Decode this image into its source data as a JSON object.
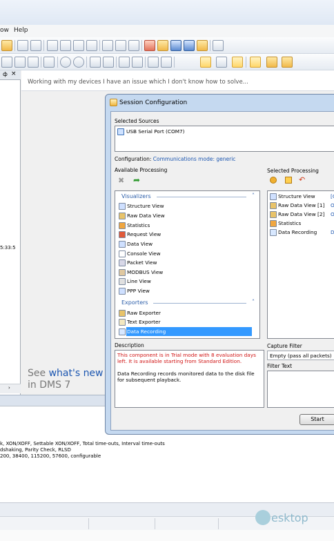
{
  "menu": {
    "view": "ow",
    "help": "Help"
  },
  "left_pane": {
    "pin": "ф",
    "close": "×",
    "timestamp": "5:33:5"
  },
  "doc": {
    "tab_text": "Working with my devices I have an issue which I don't know how to solve...",
    "whats_new_prefix": "See",
    "whats_new_link": "what's new",
    "whats_new_suffix": "in DMS 7"
  },
  "dialog": {
    "title": "Session Configuration",
    "selected_sources_label": "Selected Sources",
    "source_item": "USB Serial Port (COM7)",
    "configuration_label": "Configuration:",
    "configuration_value": "Communications mode: generic",
    "available_processing_label": "Available Processing",
    "selected_processing_label": "Selected Processing",
    "visualizers_header": "Visualizers",
    "visualizers": [
      "Structure View",
      "Raw Data View",
      "Statistics",
      "Request View",
      "Data View",
      "Console View",
      "Packet View",
      "MODBUS View",
      "Line View",
      "PPP View"
    ],
    "exporters_header": "Exporters",
    "exporters": [
      "Raw Exporter",
      "Text Exporter",
      "Data Recording"
    ],
    "selected_items": [
      {
        "name": "Structure View",
        "suffix": "[C"
      },
      {
        "name": "Raw Data View [1]",
        "suffix": "O"
      },
      {
        "name": "Raw Data View [2]",
        "suffix": "O"
      },
      {
        "name": "Statistics",
        "suffix": ""
      },
      {
        "name": "Data Recording",
        "suffix": "D"
      }
    ],
    "description_label": "Description",
    "description_trial": "This component is in Trial mode with 8 evaluation days left. It is available starting from Standard Edition.",
    "description_text": "Data Recording records monitored data to the disk file for subsequent playback.",
    "capture_filter_label": "Capture Filter",
    "capture_filter_value": "Empty (pass all packets)",
    "filter_text_label": "Filter Text",
    "start_button": "Start"
  },
  "bottom": {
    "line1": "k, XON/XOFF, Settable XON/XOFF, Total time-outs, Interval time-outs",
    "line2": "dshaking, Parity Check, RLSD",
    "line3": "200, 38400, 115200, 57600, configurable"
  },
  "watermark": "esktop",
  "colors": {
    "link": "#1a55b0",
    "trial": "#d01010",
    "selection": "#3399ff"
  }
}
